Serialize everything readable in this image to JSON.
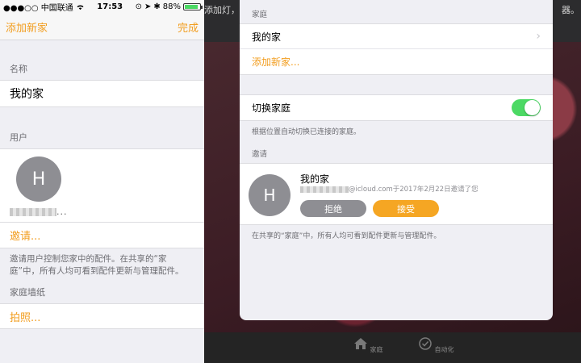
{
  "phone": {
    "status": {
      "carrier": "●●●○○ 中国联通",
      "time": "17:53",
      "battery": "88%",
      "battery_level": 0.88
    },
    "nav": {
      "left": "添加新家",
      "right": "完成"
    },
    "sections": {
      "name_label": "名称",
      "name_value": "我的家",
      "users_label": "用户",
      "user_initial": "H",
      "user_mail_suffix": "...",
      "invite_link": "邀请...",
      "invite_note": "邀请用户控制您家中的配件。在共享的“家庭”中，所有人均可看到配件更新与管理配件。",
      "wallpaper_label": "家庭墙纸",
      "photo_link": "拍照..."
    }
  },
  "ipad": {
    "status_left": "添加灯，",
    "status_right": "器。",
    "modal": {
      "home_label": "家庭",
      "my_home": "我的家",
      "add_home": "添加新家...",
      "switch_home": "切换家庭",
      "switch_on": true,
      "switch_note": "根据位置自动切换已连接的家庭。",
      "invite_label": "邀请",
      "invite_initial": "H",
      "invite_home": "我的家",
      "invite_from": "@icloud.com于2017年2月22日邀请了您",
      "decline": "拒绝",
      "accept": "接受",
      "shared_note": "在共享的“家庭”中，所有人均可看到配件更新与管理配件。"
    },
    "dock": {
      "home": "家庭",
      "automation": "自动化"
    }
  },
  "colors": {
    "accent": "#f29d1e",
    "toggle": "#4cd964",
    "avatar": "#8e8e93"
  }
}
